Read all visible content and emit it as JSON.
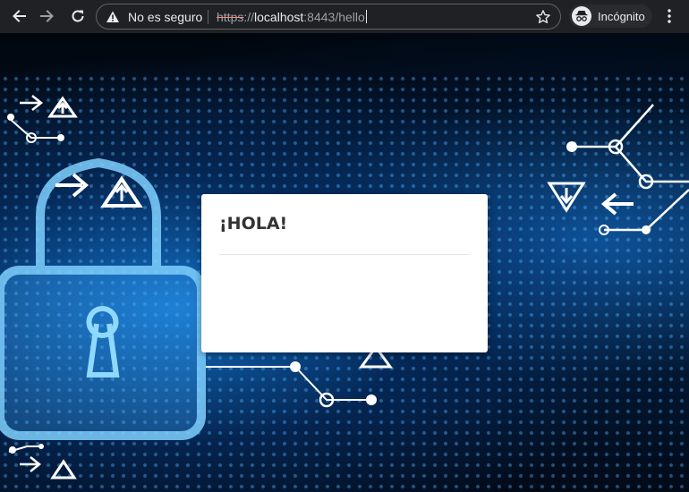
{
  "browser": {
    "security_label": "No es seguro",
    "url": {
      "scheme": "https",
      "separator": "://",
      "host": "localhost",
      "port": ":8443",
      "path": "/hello"
    },
    "incognito_label": "Incógnito"
  },
  "page": {
    "card_title": "¡HOLA!"
  },
  "icons": {
    "back": "back-arrow-icon",
    "forward": "forward-arrow-icon",
    "reload": "reload-icon",
    "warning": "warning-triangle-icon",
    "bookmark": "star-icon",
    "incognito": "incognito-icon",
    "menu": "kebab-menu-icon"
  },
  "colors": {
    "toolbar_bg": "#202124",
    "toolbar_text": "#e8eaed",
    "background_accent": "#1478d2",
    "card_bg": "#ffffff",
    "card_title": "#333333"
  }
}
